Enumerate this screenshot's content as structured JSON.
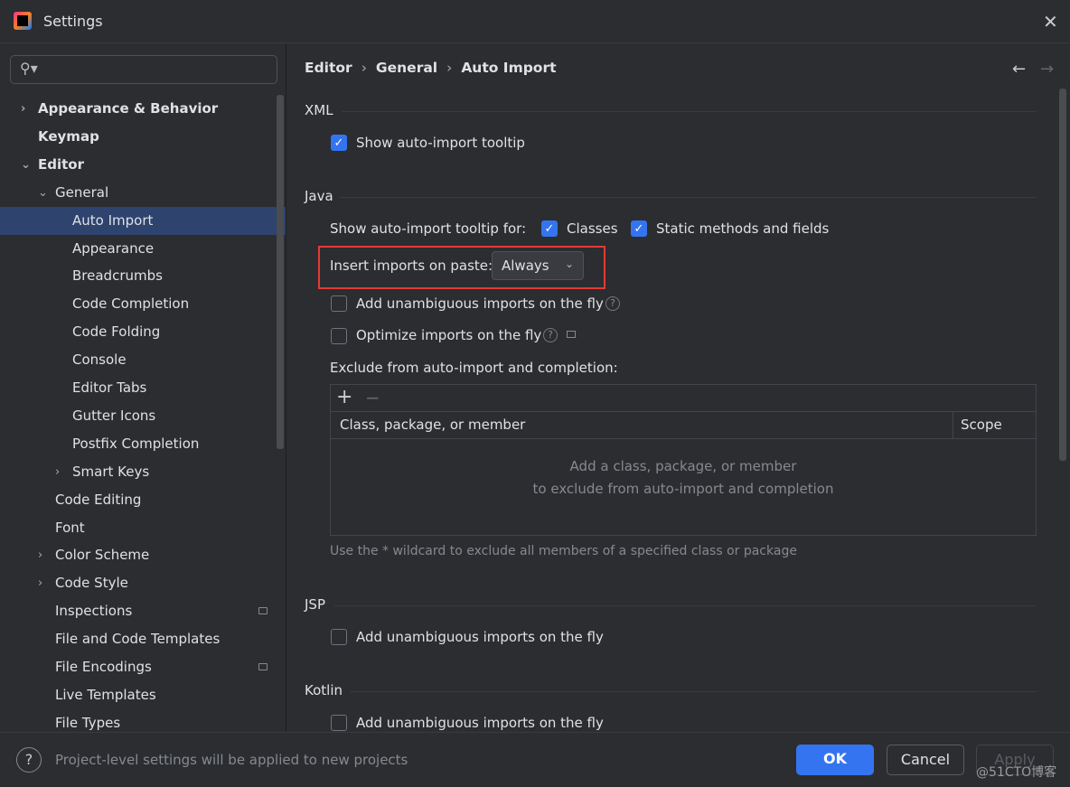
{
  "window": {
    "title": "Settings",
    "close_icon": "close-icon"
  },
  "search": {
    "placeholder": ""
  },
  "sidebar": {
    "items": [
      {
        "label": "Appearance & Behavior",
        "chevron": "›"
      },
      {
        "label": "Keymap"
      },
      {
        "label": "Editor",
        "chevron": "⌄"
      },
      {
        "label": "General",
        "chevron": "⌄"
      },
      {
        "label": "Auto Import"
      },
      {
        "label": "Appearance"
      },
      {
        "label": "Breadcrumbs"
      },
      {
        "label": "Code Completion"
      },
      {
        "label": "Code Folding"
      },
      {
        "label": "Console"
      },
      {
        "label": "Editor Tabs"
      },
      {
        "label": "Gutter Icons"
      },
      {
        "label": "Postfix Completion"
      },
      {
        "label": "Smart Keys",
        "chevron": "›"
      },
      {
        "label": "Code Editing"
      },
      {
        "label": "Font"
      },
      {
        "label": "Color Scheme",
        "chevron": "›"
      },
      {
        "label": "Code Style",
        "chevron": "›"
      },
      {
        "label": "Inspections"
      },
      {
        "label": "File and Code Templates"
      },
      {
        "label": "File Encodings"
      },
      {
        "label": "Live Templates"
      },
      {
        "label": "File Types"
      }
    ]
  },
  "breadcrumb": [
    "Editor",
    "General",
    "Auto Import"
  ],
  "sep": "›",
  "nav": {
    "back": "←",
    "forward": "→"
  },
  "xml": {
    "header": "XML",
    "tooltip": "Show auto-import tooltip"
  },
  "java": {
    "header": "Java",
    "tooltip_for": "Show auto-import tooltip for:",
    "classes": "Classes",
    "static": "Static methods and fields",
    "paste_label": "Insert imports on paste:",
    "paste_value": "Always",
    "unambiguous": "Add unambiguous imports on the fly",
    "optimize": "Optimize imports on the fly",
    "exclude_label": "Exclude from auto-import and completion:",
    "add": "+",
    "remove": "−",
    "col1": "Class, package, or member",
    "col2": "Scope",
    "empty1": "Add a class, package, or member",
    "empty2": "to exclude from auto-import and completion",
    "hint": "Use the * wildcard to exclude all members of a specified class or package"
  },
  "jsp": {
    "header": "JSP",
    "unambiguous": "Add unambiguous imports on the fly"
  },
  "kotlin": {
    "header": "Kotlin",
    "unambiguous": "Add unambiguous imports on the fly"
  },
  "footer": {
    "help": "?",
    "note": "Project-level settings will be applied to new projects",
    "ok": "OK",
    "cancel": "Cancel",
    "apply": "Apply",
    "watermark": "@51CTO博客"
  },
  "colors": {
    "accent": "#3574f0",
    "selection": "#2e436e",
    "highlight": "#e53935"
  }
}
